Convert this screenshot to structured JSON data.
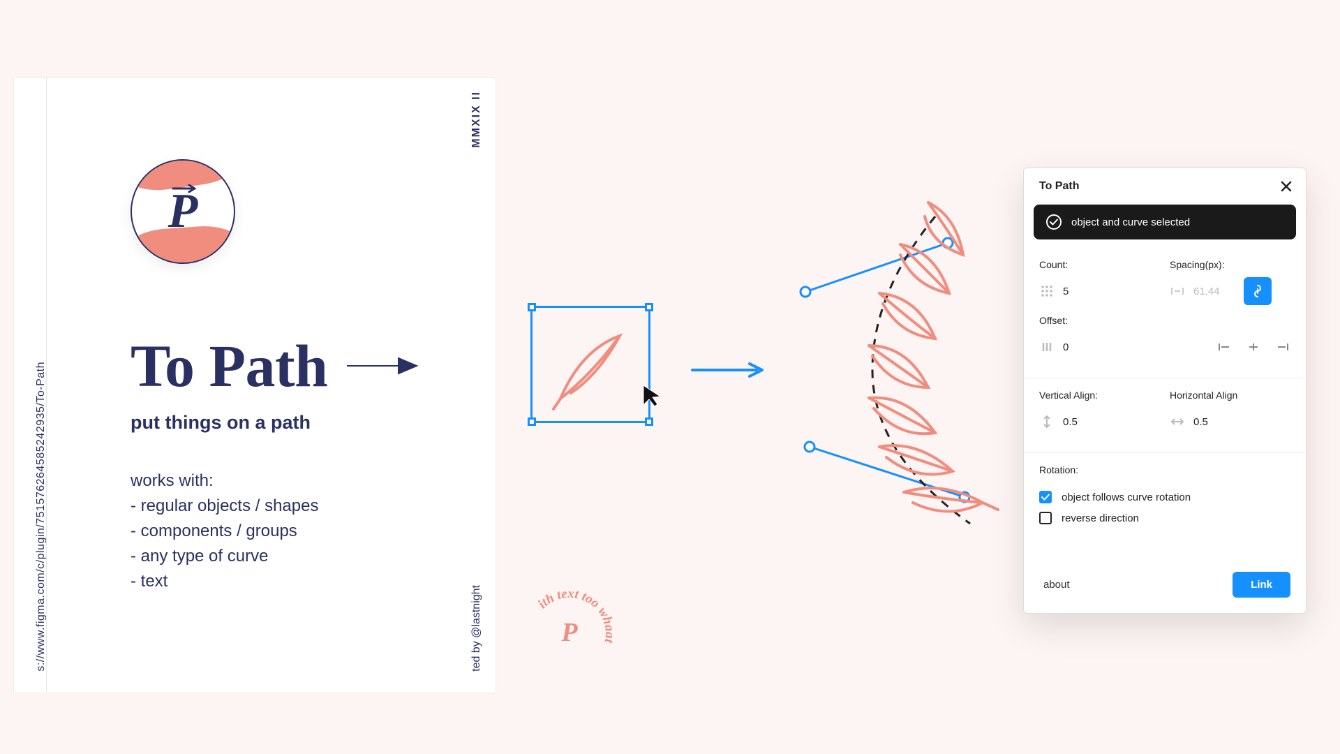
{
  "poster": {
    "logo_letter": "P",
    "title": "To Path",
    "subtitle": "put things on a path",
    "works_with_heading": "works with:",
    "works_with_items": [
      "- regular objects / shapes",
      "- components / groups",
      "- any type of curve",
      "- text"
    ],
    "url": "s://www.figma.com/c/plugin/751576264585242935/To-Path",
    "credit": "ted by @lastnight",
    "year": "MMXIX II",
    "circle_text": "ith text too whaat"
  },
  "panel": {
    "title": "To Path",
    "status": "object and curve selected",
    "count": {
      "label": "Count:",
      "value": "5"
    },
    "spacing": {
      "label": "Spacing(px):",
      "value": "61.44",
      "linked": true
    },
    "offset": {
      "label": "Offset:",
      "value": "0"
    },
    "v_align": {
      "label": "Vertical Align:",
      "value": "0.5"
    },
    "h_align": {
      "label": "Horizontal Align",
      "value": "0.5"
    },
    "rotation_label": "Rotation:",
    "cb_follows": {
      "label": "object follows curve rotation",
      "checked": true
    },
    "cb_reverse": {
      "label": "reverse direction",
      "checked": false
    },
    "about": "about",
    "link_button": "Link"
  },
  "colors": {
    "navy": "#2a3061",
    "coral": "#f08d7e",
    "blue": "#168fff"
  }
}
